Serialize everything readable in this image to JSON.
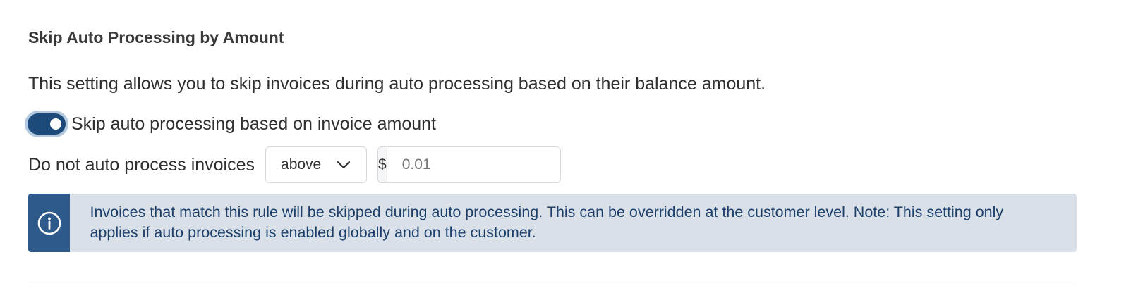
{
  "section": {
    "title": "Skip Auto Processing by Amount",
    "description": "This setting allows you to skip invoices during auto processing based on their balance amount."
  },
  "toggle": {
    "label": "Skip auto processing based on invoice amount",
    "enabled": true
  },
  "rule": {
    "label": "Do not auto process invoices",
    "comparator": "above",
    "currency_symbol": "$",
    "amount_value": "",
    "amount_placeholder": "0.01"
  },
  "info": {
    "icon": "info-circle-icon",
    "text": "Invoices that match this rule will be skipped during auto processing. This can be overridden at the customer level. Note: This setting only applies if auto processing is enabled globally and on the customer."
  },
  "colors": {
    "accent": "#1c4a7a",
    "info_bar": "#2d5a8a",
    "info_bg": "#d9e0e7",
    "info_text": "#1d3f6b"
  }
}
